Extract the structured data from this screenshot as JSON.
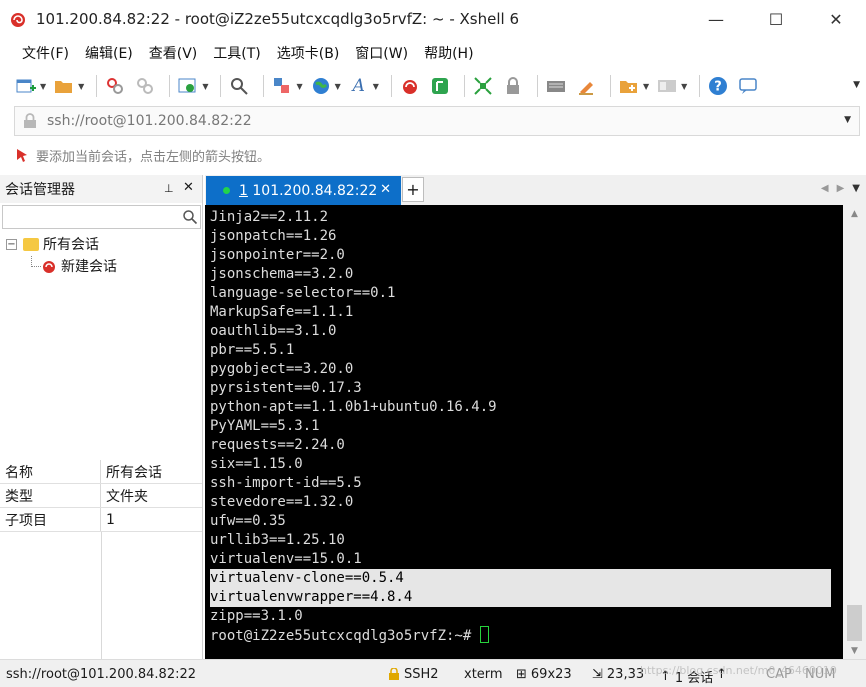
{
  "window": {
    "title": "101.200.84.82:22 - root@iZ2ze55utcxcqdlg3o5rvfZ: ~ - Xshell 6",
    "minimize": "—",
    "maximize": "☐",
    "close": "✕"
  },
  "menu": [
    "文件(F)",
    "编辑(E)",
    "查看(V)",
    "工具(T)",
    "选项卡(B)",
    "窗口(W)",
    "帮助(H)"
  ],
  "address": {
    "value": "ssh://root@101.200.84.82:22"
  },
  "hint": {
    "text": "要添加当前会话，点击左侧的箭头按钮。"
  },
  "session_manager": {
    "title": "会话管理器",
    "pin": "⊥",
    "close": "✕",
    "search_placeholder": "",
    "tree": {
      "root": "所有会话",
      "child": "新建会话"
    },
    "props": [
      {
        "key": "名称",
        "value": "所有会话"
      },
      {
        "key": "类型",
        "value": "文件夹"
      },
      {
        "key": "子项目",
        "value": "1"
      }
    ]
  },
  "tab": {
    "number": "1",
    "label": "101.200.84.82:22",
    "close": "✕",
    "add": "+"
  },
  "terminal": {
    "lines": [
      "Jinja2==2.11.2",
      "jsonpatch==1.26",
      "jsonpointer==2.0",
      "jsonschema==3.2.0",
      "language-selector==0.1",
      "MarkupSafe==1.1.1",
      "oauthlib==3.1.0",
      "pbr==5.5.1",
      "pygobject==3.20.0",
      "pyrsistent==0.17.3",
      "python-apt==1.1.0b1+ubuntu0.16.4.9",
      "PyYAML==5.3.1",
      "requests==2.24.0",
      "six==1.15.0",
      "ssh-import-id==5.5",
      "stevedore==1.32.0",
      "ufw==0.35",
      "urllib3==1.25.10",
      "virtualenv==15.0.1",
      "virtualenv-clone==0.5.4",
      "virtualenvwrapper==4.8.4",
      "zipp==3.1.0"
    ],
    "selected_lines": [
      "virtualenv-clone==0.5.4",
      "virtualenvwrapper==4.8.4"
    ],
    "prompt": "root@iZ2ze55utcxcqdlg3o5rvfZ:~# "
  },
  "status": {
    "connection": "ssh://root@101.200.84.82:22",
    "protocol": "SSH2",
    "term": "xterm",
    "size": "69x23",
    "cursor_pos": "23,33",
    "sessions": "1 会话",
    "caps": "CAP",
    "num": "NUM",
    "watermark": "https://blog.csdn.net/m0_46460010"
  },
  "colors": {
    "tab_active": "#0d6fc9",
    "terminal_bg": "#000000",
    "terminal_fg": "#dcdcdc",
    "cursor": "#27d33d",
    "session_dot": "#22d34b"
  },
  "icons": [
    "new-session-icon",
    "open-folder-icon",
    "reconnect-icon",
    "disconnect-icon",
    "properties-icon",
    "find-icon",
    "transfer-icon",
    "globe-icon",
    "font-icon",
    "xshell-icon",
    "xftp-icon",
    "fullscreen-icon",
    "lock-icon",
    "keyboard-icon",
    "highlight-icon",
    "new-tab-icon",
    "layout-icon",
    "help-icon",
    "chat-icon"
  ]
}
